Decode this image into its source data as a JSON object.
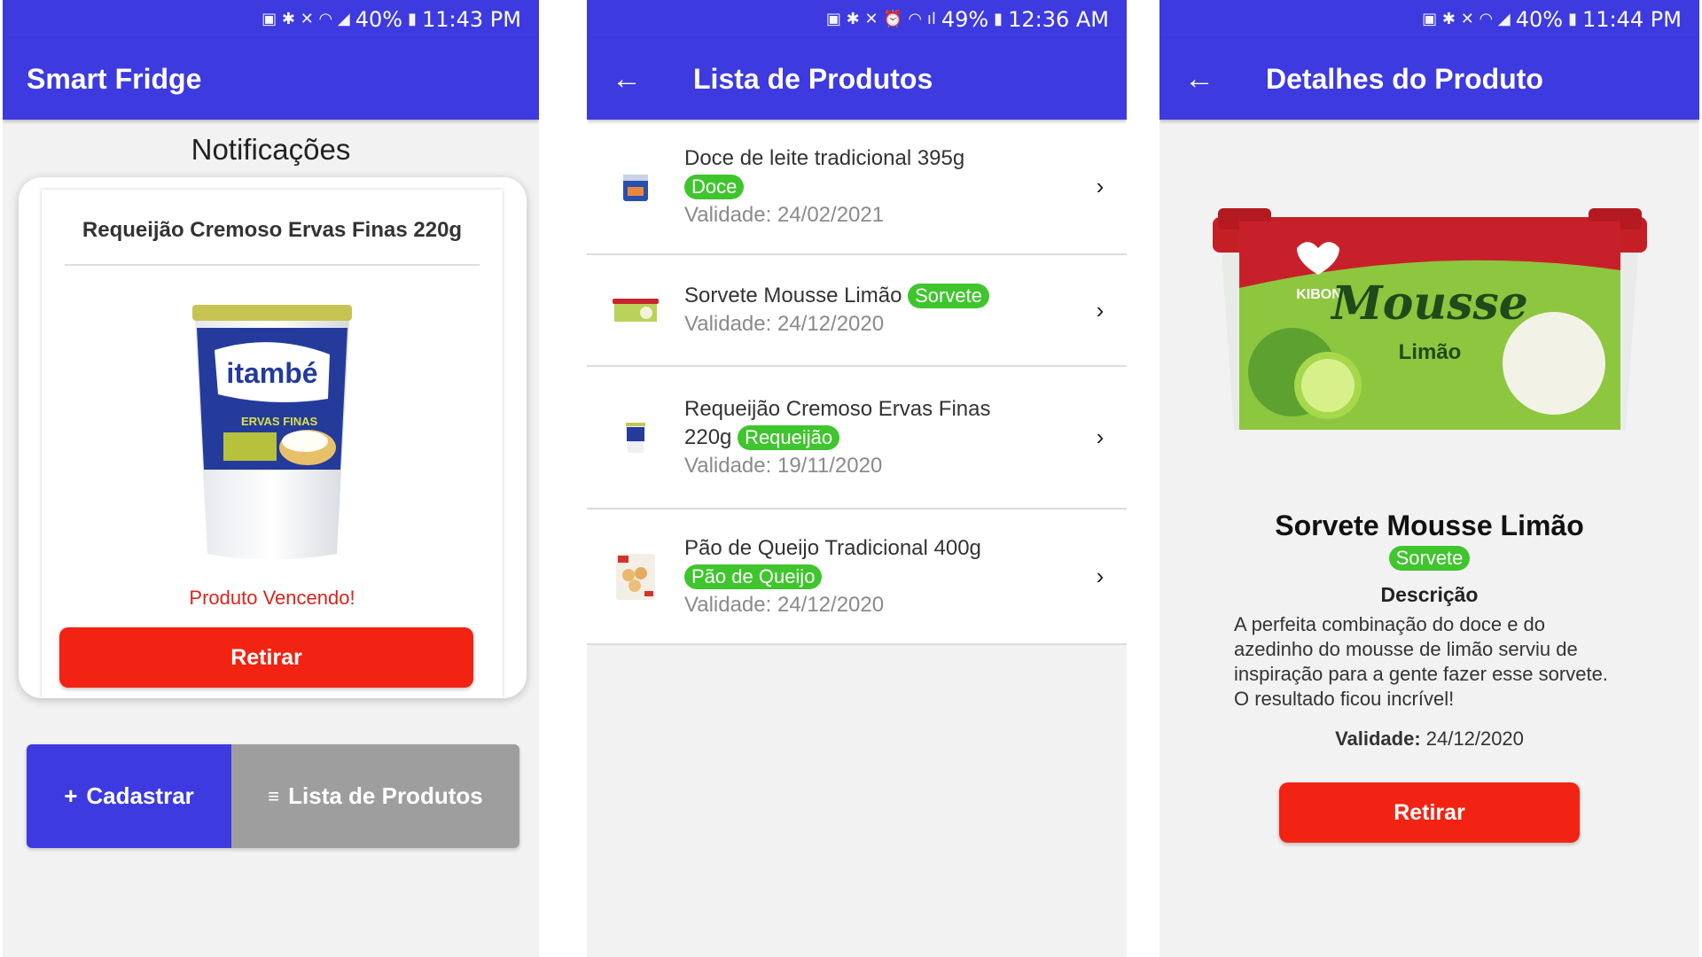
{
  "screen1": {
    "status": {
      "battery": "40%",
      "time": "11:43 PM"
    },
    "app_title": "Smart Fridge",
    "heading": "Notificações",
    "card": {
      "product_name": "Requeijão Cremoso Ervas Finas 220g",
      "alert": "Produto Vencendo!",
      "remove_label": "Retirar"
    },
    "buttons": {
      "register": "Cadastrar",
      "list": "Lista de Produtos"
    }
  },
  "screen2": {
    "status": {
      "battery": "49%",
      "time": "12:36 AM"
    },
    "title": "Lista de Produtos",
    "items": [
      {
        "name": "Doce de leite tradicional 395g",
        "tag": "Doce",
        "validity": "Validade: 24/02/2021"
      },
      {
        "name": "Sorvete Mousse Limão",
        "tag": "Sorvete",
        "validity": "Validade: 24/12/2020"
      },
      {
        "name": "Requeijão Cremoso Ervas Finas 220g",
        "tag": "Requeijão",
        "validity": "Validade: 19/11/2020"
      },
      {
        "name": "Pão de Queijo Tradicional 400g",
        "tag": "Pão de Queijo",
        "validity": "Validade: 24/12/2020"
      }
    ]
  },
  "screen3": {
    "status": {
      "battery": "40%",
      "time": "11:44 PM"
    },
    "title": "Detalhes do Produto",
    "product_name": "Sorvete Mousse Limão",
    "tag": "Sorvete",
    "description_label": "Descrição",
    "description": "A perfeita combinação do doce e do azedinho do mousse de limão serviu de inspiração para a gente fazer esse sorvete. O resultado ficou incrível!",
    "validity_label": "Validade:",
    "validity_value": "24/12/2020",
    "remove_label": "Retirar",
    "image_text": {
      "brand": "KIBON",
      "line1": "Mousse",
      "line2": "Limão"
    }
  },
  "jar_text": {
    "brand": "itambé",
    "flavor": "ERVAS FINAS"
  },
  "colors": {
    "primary": "#3d3ae0",
    "danger": "#f22312",
    "tag": "#3fc52d",
    "secondary": "#9e9e9e"
  }
}
